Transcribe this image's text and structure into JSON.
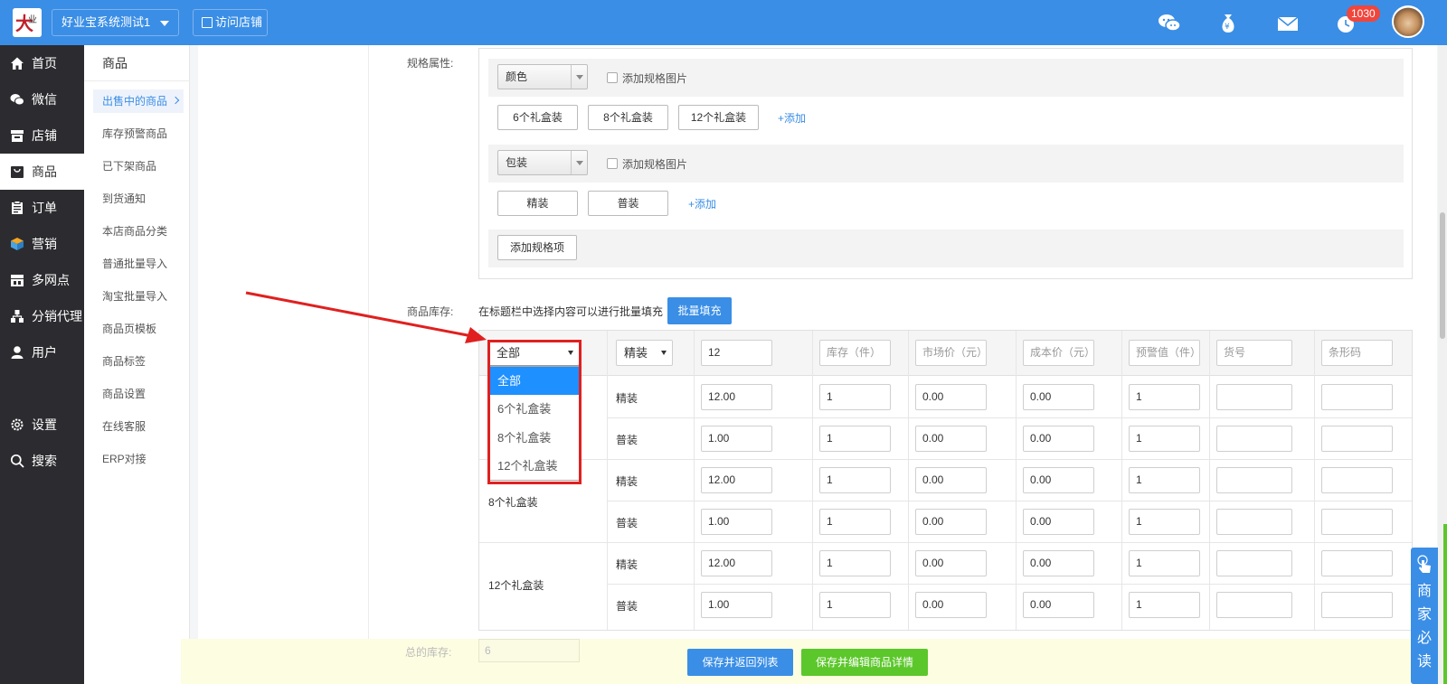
{
  "topbar": {
    "shop_name": "好业宝系统测试1",
    "visit_store": "访问店铺",
    "notification_count": "1030"
  },
  "leftnav": {
    "items": [
      {
        "label": "首页",
        "icon": "home-icon"
      },
      {
        "label": "微信",
        "icon": "wechat-icon"
      },
      {
        "label": "店铺",
        "icon": "store-icon"
      },
      {
        "label": "商品",
        "icon": "bag-icon"
      },
      {
        "label": "订单",
        "icon": "clipboard-icon"
      },
      {
        "label": "营销",
        "icon": "cube-icon"
      },
      {
        "label": "多网点",
        "icon": "branches-icon"
      },
      {
        "label": "分销代理",
        "icon": "org-icon"
      },
      {
        "label": "用户",
        "icon": "user-icon"
      },
      {
        "label": "设置",
        "icon": "gear-icon"
      },
      {
        "label": "搜索",
        "icon": "search-icon"
      }
    ]
  },
  "subnav": {
    "title": "商品",
    "items": [
      "出售中的商品",
      "库存预警商品",
      "已下架商品",
      "到货通知",
      "本店商品分类",
      "普通批量导入",
      "淘宝批量导入",
      "商品页模板",
      "商品标签",
      "商品设置",
      "在线客服",
      "ERP对接"
    ]
  },
  "spec": {
    "label": "规格属性:",
    "groups": [
      {
        "name": "颜色",
        "add_image": "添加规格图片",
        "values": [
          "6个礼盒装",
          "8个礼盒装",
          "12个礼盒装"
        ],
        "add": "+添加"
      },
      {
        "name": "包装",
        "add_image": "添加规格图片",
        "values": [
          "精装",
          "普装"
        ],
        "add": "+添加"
      }
    ],
    "add_spec_item": "添加规格项"
  },
  "stock": {
    "label": "商品库存:",
    "hint": "在标题栏中选择内容可以进行批量填充",
    "batch_fill": "批量填充",
    "header": {
      "filter1": "全部",
      "filter2": "精装",
      "price_value": "12",
      "stock_ph": "库存（件）",
      "market_ph": "市场价（元）",
      "cost_ph": "成本价（元）",
      "warn_ph": "预警值（件）",
      "sku_ph": "货号",
      "barcode_ph": "条形码"
    },
    "dropdown": [
      "全部",
      "6个礼盒装",
      "8个礼盒装",
      "12个礼盒装"
    ],
    "groups": [
      "6个礼盒装",
      "8个礼盒装",
      "12个礼盒装"
    ],
    "rows": [
      {
        "pack": "精装",
        "price": "12.00",
        "stock": "1",
        "market": "0.00",
        "cost": "0.00",
        "warn": "1"
      },
      {
        "pack": "普装",
        "price": "1.00",
        "stock": "1",
        "market": "0.00",
        "cost": "0.00",
        "warn": "1"
      },
      {
        "pack": "精装",
        "price": "12.00",
        "stock": "1",
        "market": "0.00",
        "cost": "0.00",
        "warn": "1"
      },
      {
        "pack": "普装",
        "price": "1.00",
        "stock": "1",
        "market": "0.00",
        "cost": "0.00",
        "warn": "1"
      },
      {
        "pack": "精装",
        "price": "12.00",
        "stock": "1",
        "market": "0.00",
        "cost": "0.00",
        "warn": "1"
      },
      {
        "pack": "普装",
        "price": "1.00",
        "stock": "1",
        "market": "0.00",
        "cost": "0.00",
        "warn": "1"
      }
    ]
  },
  "total": {
    "label": "总的库存:",
    "value": "6"
  },
  "footer": {
    "save_return": "保存并返回列表",
    "save_edit": "保存并编辑商品详情"
  },
  "side_widget": {
    "chars": [
      "商",
      "家",
      "必",
      "读"
    ]
  },
  "colors": {
    "primary": "#3a8ee6",
    "green": "#5cc72b",
    "nav_dark": "#2c2c30",
    "badge_red": "#f0463c",
    "annotation_red": "#e02020"
  }
}
